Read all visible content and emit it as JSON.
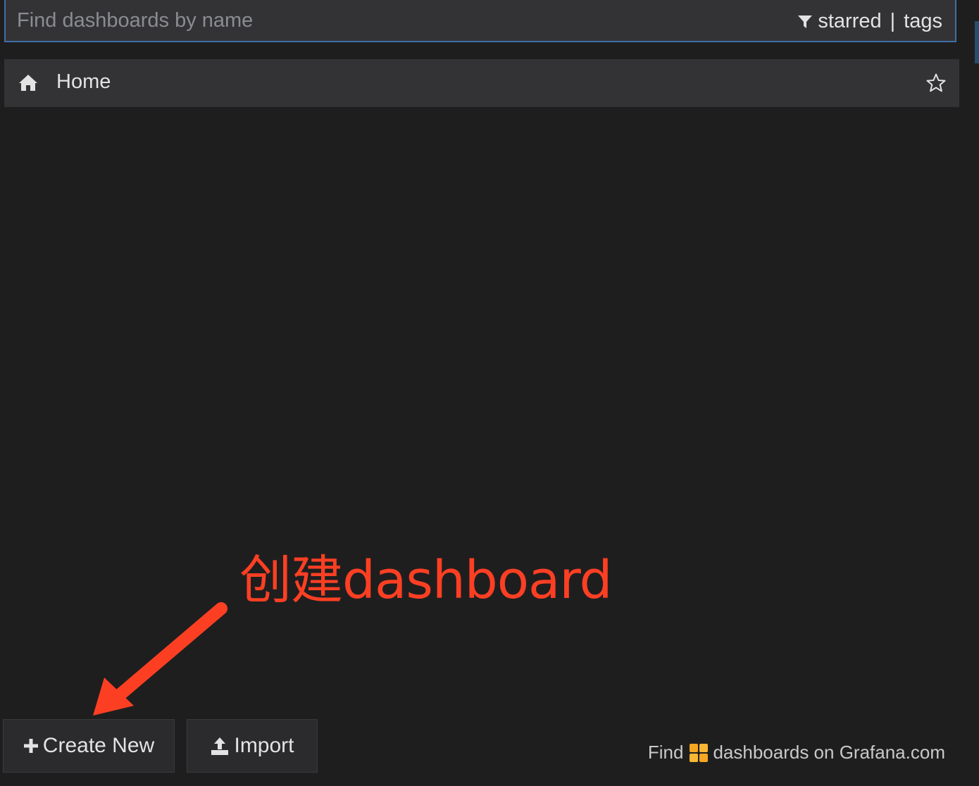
{
  "search": {
    "placeholder": "Find dashboards by name",
    "filter_starred": "starred",
    "filter_separator": "|",
    "filter_tags": "tags"
  },
  "dashboards": [
    {
      "title": "Home",
      "icon": "home-icon",
      "starred": false
    }
  ],
  "annotation": {
    "text": "创建dashboard",
    "color": "#fc3f23"
  },
  "actions": {
    "create_new_label": "Create New",
    "import_label": "Import"
  },
  "footer": {
    "prefix": "Find",
    "suffix": "dashboards on Grafana.com"
  },
  "colors": {
    "background": "#1f1e1f",
    "panel": "#333335",
    "focus_border": "#3f6fa8",
    "annotation": "#fc3f23",
    "grafana_orange": "#f5a623"
  }
}
